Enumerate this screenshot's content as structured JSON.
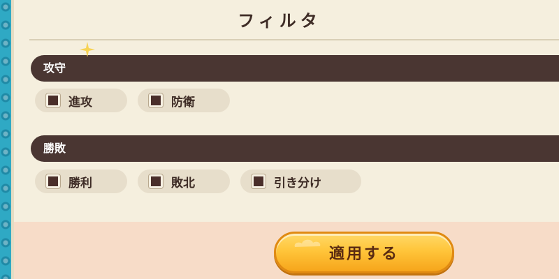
{
  "dialog": {
    "title": "フィルタ"
  },
  "sections": [
    {
      "label": "攻守",
      "options": [
        {
          "label": "進攻"
        },
        {
          "label": "防衛"
        }
      ]
    },
    {
      "label": "勝敗",
      "options": [
        {
          "label": "勝利"
        },
        {
          "label": "敗北"
        },
        {
          "label": "引き分け"
        }
      ]
    }
  ],
  "apply_button": {
    "label": "適用する"
  },
  "colors": {
    "section_bar": "#4a3632",
    "panel": "#f5efde",
    "footer": "#f7dcc8",
    "button": "#ffc53a",
    "border": "#2fa9c4"
  }
}
